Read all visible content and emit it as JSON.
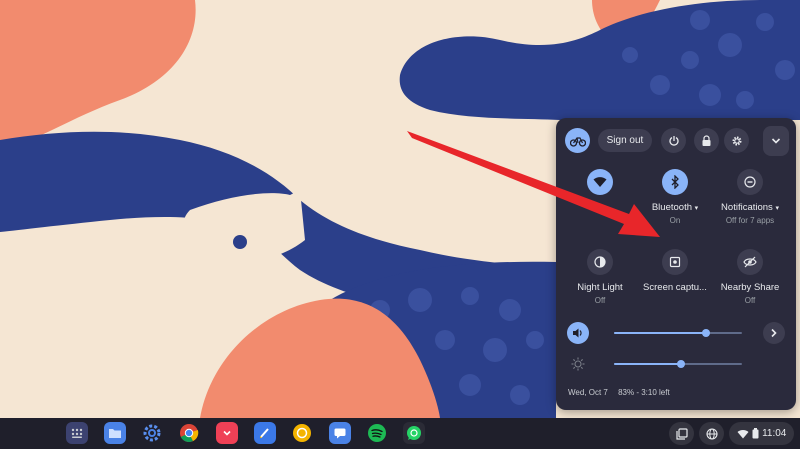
{
  "quick_settings": {
    "sign_out_label": "Sign out",
    "tiles": [
      {
        "label": "",
        "sublabel": "",
        "icon": "wifi-icon",
        "active": true
      },
      {
        "label": "Bluetooth",
        "sublabel": "On",
        "icon": "bluetooth-icon",
        "active": true
      },
      {
        "label": "Notifications",
        "sublabel": "Off for 7 apps",
        "icon": "do-not-disturb-icon",
        "active": false
      },
      {
        "label": "Night Light",
        "sublabel": "Off",
        "icon": "night-light-icon",
        "active": false
      },
      {
        "label": "Screen captu...",
        "sublabel": "",
        "icon": "screen-capture-icon",
        "active": false
      },
      {
        "label": "Nearby Share",
        "sublabel": "Off",
        "icon": "nearby-share-icon",
        "active": false
      }
    ],
    "volume_level": 0.72,
    "brightness_level": 0.52,
    "date": "Wed, Oct 7",
    "battery": "83% - 3:10 left"
  },
  "shelf": {
    "apps": [
      "launcher-icon",
      "files-icon",
      "settings-icon",
      "chrome-icon",
      "pocket-icon",
      "docs-icon",
      "keep-icon",
      "messages-icon",
      "spotify-icon",
      "whatsapp-icon"
    ],
    "time": "11:04"
  },
  "colors": {
    "accent": "#8ab4f8",
    "panel": "#2a2a3c",
    "wallpaper_blue": "#2b3f8a",
    "wallpaper_coral": "#f28b6e",
    "wallpaper_cream": "#f5e6d3",
    "arrow": "#e8262a"
  }
}
